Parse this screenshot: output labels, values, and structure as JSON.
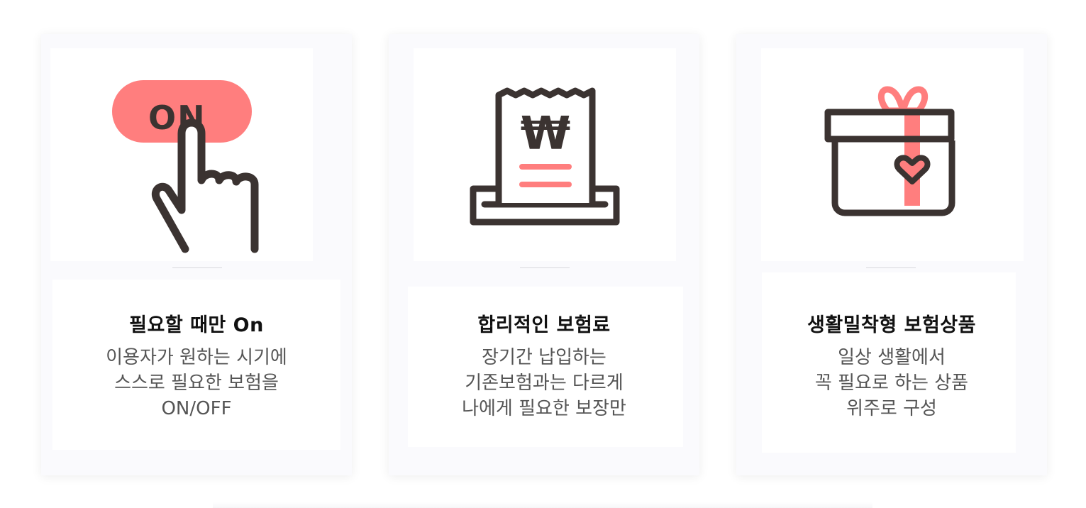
{
  "colors": {
    "accent": "#ff7e7e",
    "line": "#3b3331"
  },
  "cards": [
    {
      "icon": "on-toggle-hand-icon",
      "icon_text": "ON",
      "title": "필요할 때만 On",
      "desc": [
        "이용자가 원하는 시기에",
        "스스로 필요한 보험을",
        "ON/OFF"
      ]
    },
    {
      "icon": "won-receipt-icon",
      "icon_text": "₩",
      "title": "합리적인 보험료",
      "desc": [
        "장기간 납입하는",
        "기존보험과는 다르게",
        "나에게 필요한 보장만"
      ]
    },
    {
      "icon": "gift-box-heart-icon",
      "title": "생활밀착형 보험상품",
      "desc": [
        "일상 생활에서",
        "꼭 필요로 하는 상품",
        "위주로 구성"
      ]
    }
  ]
}
